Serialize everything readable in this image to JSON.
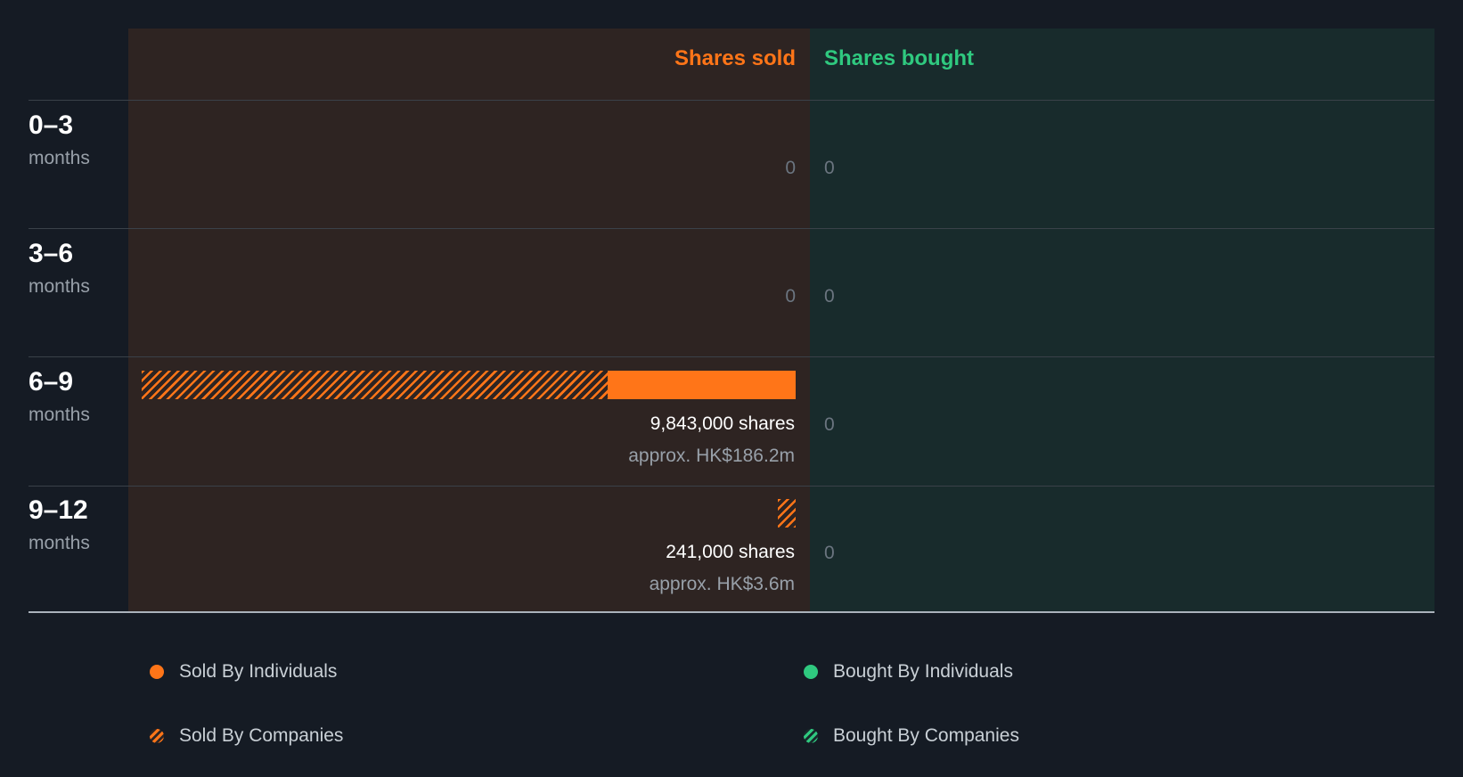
{
  "chart_data": {
    "type": "bar",
    "headers": {
      "sold": "Shares sold",
      "bought": "Shares bought"
    },
    "rows": [
      {
        "range": "0–3",
        "unit": "months",
        "sold_individuals": 0,
        "sold_companies": 0,
        "sold_total_label": "0",
        "bought_total_label": "0"
      },
      {
        "range": "3–6",
        "unit": "months",
        "sold_individuals": 0,
        "sold_companies": 0,
        "sold_total_label": "0",
        "bought_total_label": "0"
      },
      {
        "range": "6–9",
        "unit": "months",
        "sold_individuals": 2832000,
        "sold_companies": 7011000,
        "shares_label": "9,843,000 shares",
        "approx_label": "approx. HK$186.2m",
        "bought_total_label": "0"
      },
      {
        "range": "9–12",
        "unit": "months",
        "sold_individuals": 0,
        "sold_companies": 241000,
        "shares_label": "241,000 shares",
        "approx_label": "approx. HK$3.6m",
        "bought_total_label": "0"
      }
    ],
    "max_value": 9843000,
    "legend": [
      "Sold By Individuals",
      "Bought By Individuals",
      "Sold By Companies",
      "Bought By Companies"
    ],
    "colors": {
      "sold": "#ff7518",
      "bought": "#2fc97f",
      "sold_bg": "#2e2422",
      "bought_bg": "#182b2c",
      "page_bg": "#151b24"
    }
  }
}
